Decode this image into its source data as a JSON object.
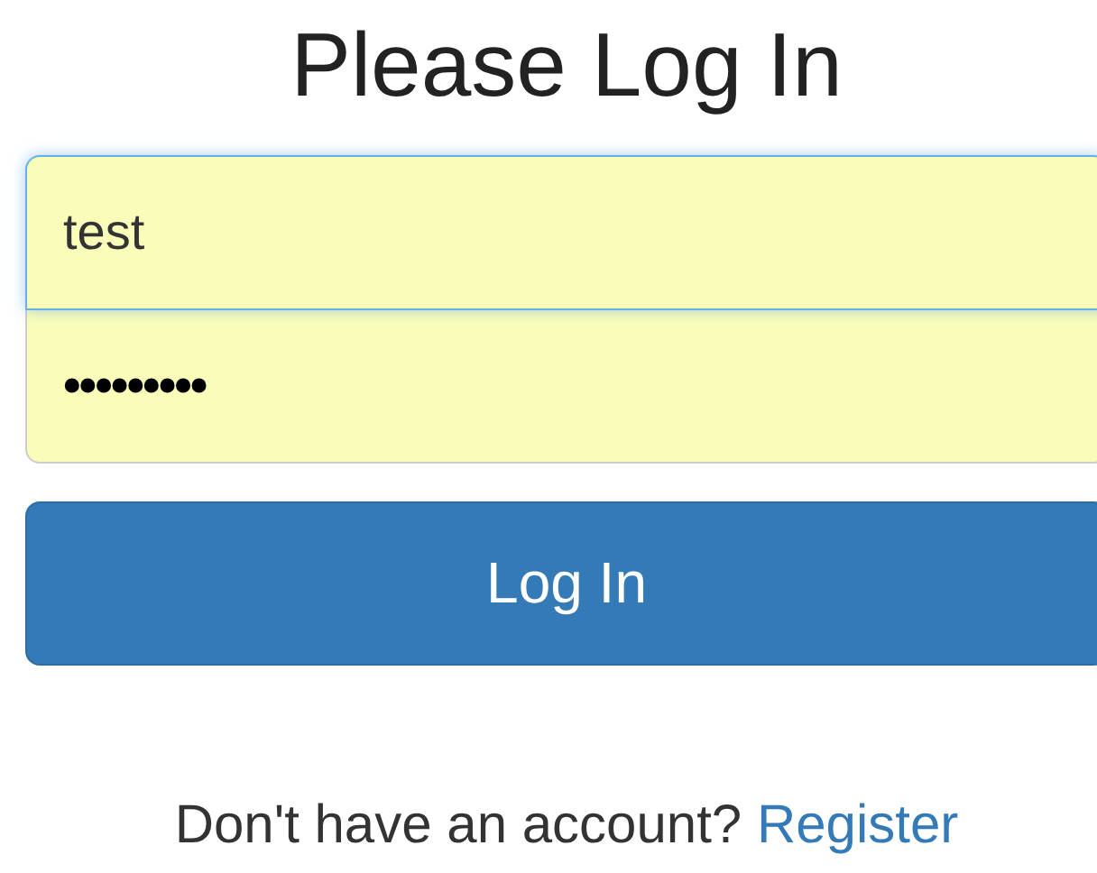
{
  "title": "Please Log In",
  "fields": [
    {
      "kind": "text",
      "value": "test",
      "focused": true
    },
    {
      "kind": "password",
      "value": "•••••••••",
      "focused": false
    }
  ],
  "submit": {
    "label": "Log In"
  },
  "footer": {
    "text": "Don't have an account?",
    "link": "Register"
  }
}
